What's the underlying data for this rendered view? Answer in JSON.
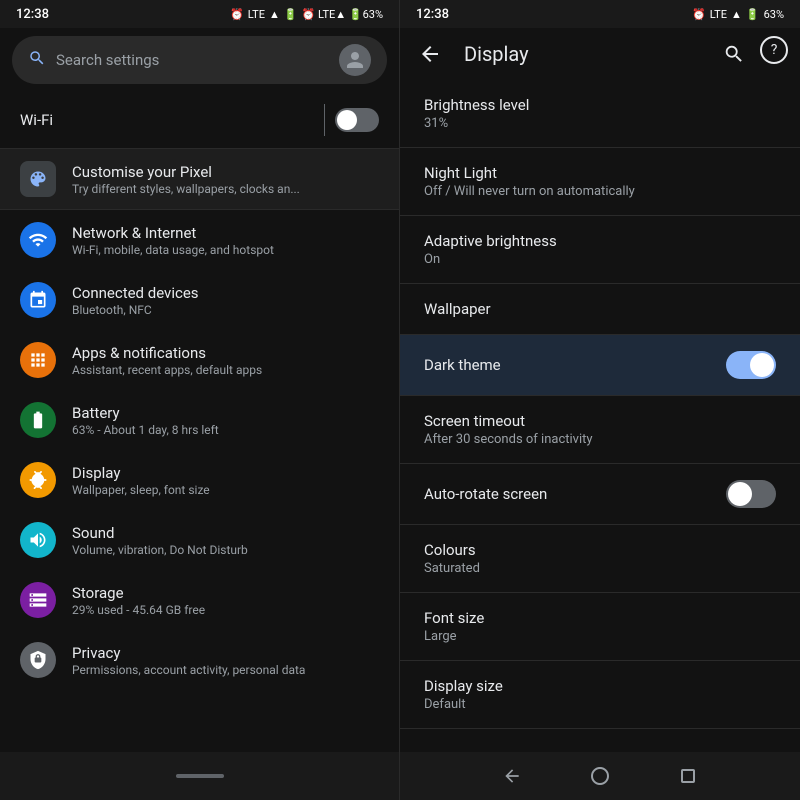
{
  "left": {
    "status": {
      "time": "12:38",
      "icons": "⏰ LTE▲ 🔋63%"
    },
    "search": {
      "placeholder": "Search settings"
    },
    "wifi": {
      "label": "Wi-Fi",
      "enabled": false
    },
    "customise": {
      "title": "Customise your Pixel",
      "subtitle": "Try different styles, wallpapers, clocks an..."
    },
    "items": [
      {
        "title": "Network & Internet",
        "subtitle": "Wi-Fi, mobile, data usage, and hotspot",
        "iconColor": "icon-blue",
        "icon": "📶"
      },
      {
        "title": "Connected devices",
        "subtitle": "Bluetooth, NFC",
        "iconColor": "icon-blue",
        "icon": "📡"
      },
      {
        "title": "Apps & notifications",
        "subtitle": "Assistant, recent apps, default apps",
        "iconColor": "icon-orange",
        "icon": "⚙"
      },
      {
        "title": "Battery",
        "subtitle": "63% - About 1 day, 8 hrs left",
        "iconColor": "icon-green",
        "icon": "🔋"
      },
      {
        "title": "Display",
        "subtitle": "Wallpaper, sleep, font size",
        "iconColor": "icon-yellow",
        "icon": "☀"
      },
      {
        "title": "Sound",
        "subtitle": "Volume, vibration, Do Not Disturb",
        "iconColor": "icon-cyan",
        "icon": "🔊"
      },
      {
        "title": "Storage",
        "subtitle": "29% used - 45.64 GB free",
        "iconColor": "icon-purple",
        "icon": "☰"
      },
      {
        "title": "Privacy",
        "subtitle": "Permissions, account activity, personal data",
        "iconColor": "icon-gray",
        "icon": "🔒"
      }
    ]
  },
  "right": {
    "status": {
      "time": "12:38",
      "icons": "⏰ LTE▲ 🔋63%"
    },
    "header": {
      "title": "Display",
      "back_label": "←",
      "search_label": "🔍",
      "help_label": "?"
    },
    "items": [
      {
        "title": "Brightness level",
        "subtitle": "31%",
        "hasToggle": false,
        "toggleOn": false,
        "active": false
      },
      {
        "title": "Night Light",
        "subtitle": "Off / Will never turn on automatically",
        "hasToggle": false,
        "toggleOn": false,
        "active": false
      },
      {
        "title": "Adaptive brightness",
        "subtitle": "On",
        "hasToggle": false,
        "toggleOn": false,
        "active": false
      },
      {
        "title": "Wallpaper",
        "subtitle": "",
        "hasToggle": false,
        "toggleOn": false,
        "active": false
      },
      {
        "title": "Dark theme",
        "subtitle": "",
        "hasToggle": true,
        "toggleOn": true,
        "active": true
      },
      {
        "title": "Screen timeout",
        "subtitle": "After 30 seconds of inactivity",
        "hasToggle": false,
        "toggleOn": false,
        "active": false
      },
      {
        "title": "Auto-rotate screen",
        "subtitle": "",
        "hasToggle": true,
        "toggleOn": false,
        "active": false
      },
      {
        "title": "Colours",
        "subtitle": "Saturated",
        "hasToggle": false,
        "toggleOn": false,
        "active": false
      },
      {
        "title": "Font size",
        "subtitle": "Large",
        "hasToggle": false,
        "toggleOn": false,
        "active": false
      },
      {
        "title": "Display size",
        "subtitle": "Default",
        "hasToggle": false,
        "toggleOn": false,
        "active": false
      }
    ],
    "nav": {
      "back": "◀",
      "home": "⬤",
      "recents": "▪"
    }
  }
}
